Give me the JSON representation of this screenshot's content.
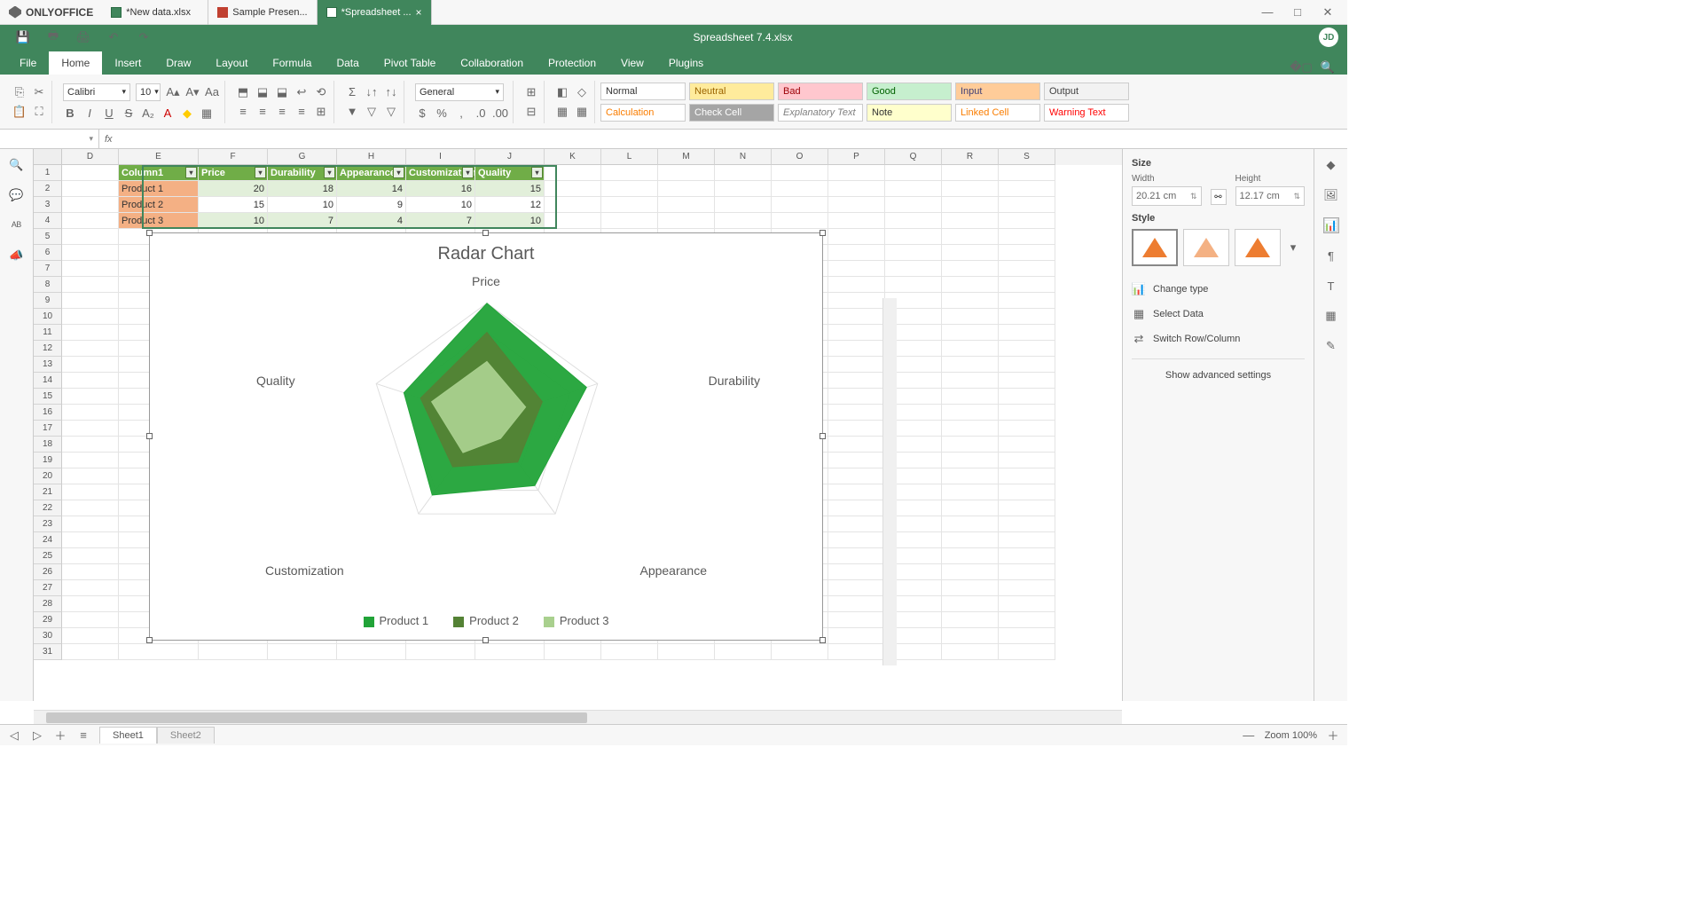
{
  "app": {
    "name": "ONLYOFFICE"
  },
  "docTabs": [
    {
      "icon": "xls",
      "label": "*New data.xlsx",
      "active": false
    },
    {
      "icon": "ppt",
      "label": "Sample Presen...",
      "active": false
    },
    {
      "icon": "xls",
      "label": "*Spreadsheet ...",
      "active": true
    }
  ],
  "docHeader": {
    "title": "Spreadsheet 7.4.xlsx",
    "user": "JD"
  },
  "menuTabs": [
    "File",
    "Home",
    "Insert",
    "Draw",
    "Layout",
    "Formula",
    "Data",
    "Pivot Table",
    "Collaboration",
    "Protection",
    "View",
    "Plugins"
  ],
  "activeMenuTab": "Home",
  "ribbon": {
    "font": {
      "name": "Calibri",
      "size": "10"
    },
    "numberFormat": "General",
    "styles": [
      {
        "cls": "cs-normal",
        "label": "Normal"
      },
      {
        "cls": "cs-neutral",
        "label": "Neutral"
      },
      {
        "cls": "cs-bad",
        "label": "Bad"
      },
      {
        "cls": "cs-good",
        "label": "Good"
      },
      {
        "cls": "cs-input",
        "label": "Input"
      },
      {
        "cls": "cs-output",
        "label": "Output"
      },
      {
        "cls": "cs-calc",
        "label": "Calculation"
      },
      {
        "cls": "cs-check",
        "label": "Check Cell"
      },
      {
        "cls": "cs-explan",
        "label": "Explanatory Text"
      },
      {
        "cls": "cs-note",
        "label": "Note"
      },
      {
        "cls": "cs-linked",
        "label": "Linked Cell"
      },
      {
        "cls": "cs-warn",
        "label": "Warning Text"
      }
    ]
  },
  "nameBox": "",
  "columns": [
    "D",
    "E",
    "F",
    "G",
    "H",
    "I",
    "J",
    "K",
    "L",
    "M",
    "N",
    "O",
    "P",
    "Q",
    "R",
    "S"
  ],
  "table": {
    "headers": [
      "Column1",
      "Price",
      "Durability",
      "Appearance",
      "Customization",
      "Quality"
    ],
    "rows": [
      {
        "label": "Product 1",
        "vals": [
          20,
          18,
          14,
          16,
          15
        ]
      },
      {
        "label": "Product 2",
        "vals": [
          15,
          10,
          9,
          10,
          12
        ]
      },
      {
        "label": "Product 3",
        "vals": [
          10,
          7,
          4,
          7,
          10
        ]
      }
    ]
  },
  "chart": {
    "title": "Radar Chart",
    "axes": [
      "Price",
      "Durability",
      "Appearance",
      "Customization",
      "Quality"
    ],
    "legend": [
      "Product 1",
      "Product 2",
      "Product 3"
    ],
    "colors": [
      "#2ca02c",
      "#548235",
      "#a9d08e"
    ]
  },
  "chart_data": {
    "type": "radar",
    "title": "Radar Chart",
    "categories": [
      "Price",
      "Durability",
      "Appearance",
      "Customization",
      "Quality"
    ],
    "series": [
      {
        "name": "Product 1",
        "values": [
          20,
          18,
          14,
          16,
          15
        ],
        "color": "#21a338"
      },
      {
        "name": "Product 2",
        "values": [
          15,
          10,
          9,
          10,
          12
        ],
        "color": "#548235"
      },
      {
        "name": "Product 3",
        "values": [
          10,
          7,
          4,
          7,
          10
        ],
        "color": "#a9d08e"
      }
    ],
    "max": 20
  },
  "rightPanel": {
    "sizeLabel": "Size",
    "widthLabel": "Width",
    "heightLabel": "Height",
    "width": "20.21 cm",
    "height": "12.17 cm",
    "styleLabel": "Style",
    "changeType": "Change type",
    "selectData": "Select Data",
    "switchRC": "Switch Row/Column",
    "advanced": "Show advanced settings"
  },
  "sheets": [
    "Sheet1",
    "Sheet2"
  ],
  "activeSheet": "Sheet1",
  "zoom": "Zoom 100%"
}
